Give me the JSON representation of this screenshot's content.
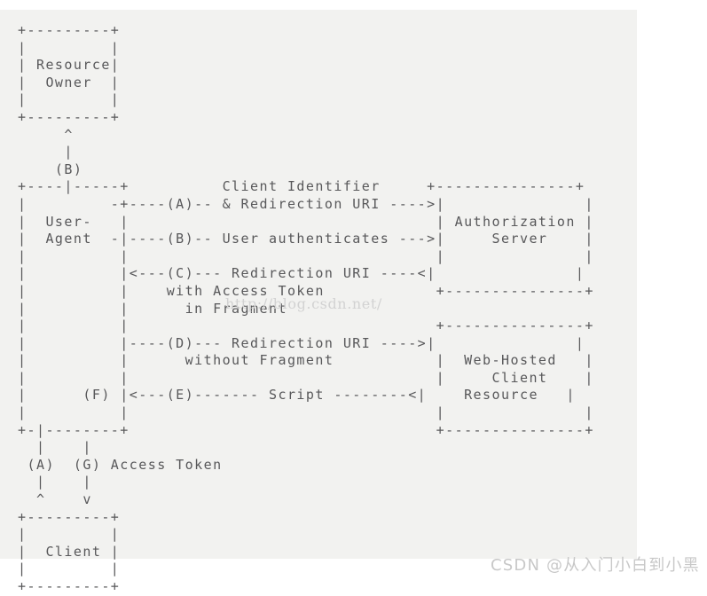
{
  "meta": {
    "diagram_title": "OAuth 2.0 Implicit Grant Flow (ASCII art)",
    "panel_color": "#f2f2f0",
    "text_color": "#58585a",
    "page_background": "#ffffff"
  },
  "diagram": {
    "ascii": "+---------+\n|         |\n| Resource|\n|  Owner  |\n|         |\n+---------+\n     ^\n     |\n    (B)\n+----|-----+          Client Identifier     +---------------+\n|         -+----(A)-- & Redirection URI ---->|               |\n|  User-   |                                 | Authorization |\n|  Agent  -|----(B)-- User authenticates --->|     Server    |\n|          |                                 |               |\n|          |<---(C)--- Redirection URI ----<|               |\n|          |    with Access Token            +---------------+\n|          |      in Fragment\n|          |                                 +---------------+\n|          |----(D)--- Redirection URI ---->|               |\n|          |      without Fragment           |  Web-Hosted   |\n|          |                                 |     Client    |\n|      (F) |<---(E)------- Script --------<|    Resource   |\n|          |                                 |               |\n+-|--------+                                 +---------------+\n  |    |\n (A)  (G) Access Token\n  |    |\n  ^    v\n+---------+\n|         |\n|  Client |\n|         |\n+---------+",
    "nodes": [
      {
        "id": "resource-owner",
        "label_lines": [
          "Resource",
          "Owner"
        ]
      },
      {
        "id": "user-agent",
        "label_lines": [
          "User-",
          "Agent"
        ]
      },
      {
        "id": "authorization-server",
        "label_lines": [
          "Authorization",
          "Server"
        ]
      },
      {
        "id": "web-hosted-client-resource",
        "label_lines": [
          "Web-Hosted",
          "Client",
          "Resource"
        ]
      },
      {
        "id": "client",
        "label_lines": [
          "Client"
        ]
      }
    ],
    "steps": [
      {
        "key": "(A)",
        "text": "Client Identifier & Redirection URI",
        "direction": "--->"
      },
      {
        "key": "(B)",
        "text": "User authenticates",
        "direction": "--->"
      },
      {
        "key": "(B)",
        "text": "",
        "direction": "^",
        "note": "Resource Owner to User-Agent"
      },
      {
        "key": "(C)",
        "text": "Redirection URI with Access Token in Fragment",
        "direction": "<---"
      },
      {
        "key": "(D)",
        "text": "Redirection URI without Fragment",
        "direction": "--->"
      },
      {
        "key": "(E)",
        "text": "Script",
        "direction": "<---"
      },
      {
        "key": "(F)",
        "text": "",
        "direction": "",
        "note": "User-Agent internal"
      },
      {
        "key": "(A)",
        "text": "",
        "direction": "^",
        "note": "Client to User-Agent"
      },
      {
        "key": "(G)",
        "text": "Access Token",
        "direction": "v"
      }
    ],
    "labels": {
      "client_identifier": "Client Identifier",
      "redirection_uri_amp": "& Redirection URI",
      "user_authenticates": "User authenticates",
      "redirection_uri": "Redirection URI",
      "with_access_token": "with Access Token",
      "in_fragment": "in Fragment",
      "without_fragment": "without Fragment",
      "script": "Script",
      "access_token": "Access Token"
    }
  },
  "watermarks": {
    "url": "http://blog.csdn.net/",
    "csdn": "CSDN @从入门小白到小黑"
  }
}
